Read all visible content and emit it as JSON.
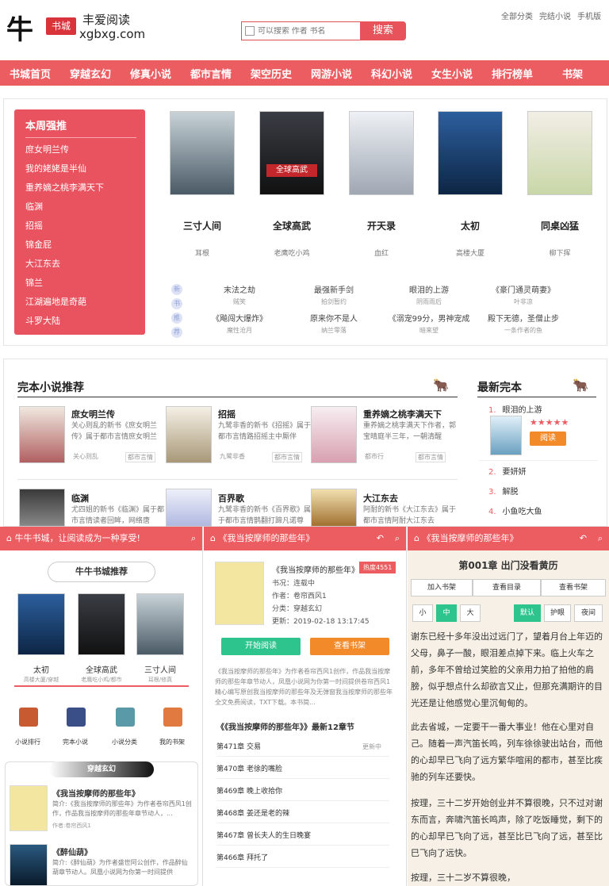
{
  "header": {
    "logo_char": "牛",
    "logo_badge": "书城",
    "logo_text1": "丰爱阅读",
    "logo_text2": "xgbxg.com",
    "search_placeholder": "可以搜索 作者 书名",
    "search_button": "搜索",
    "top_links": [
      "全部分类",
      "完结小说",
      "手机版"
    ]
  },
  "nav": [
    "书城首页",
    "穿越玄幻",
    "修真小说",
    "都市言情",
    "架空历史",
    "网游小说",
    "科幻小说",
    "女生小说",
    "排行榜单",
    "书架"
  ],
  "weekly": {
    "title": "本周强推",
    "items": [
      "庶女明兰传",
      "我的姥姥是半仙",
      "重养嫡之桃李满天下",
      "临渊",
      "招摇",
      "锦金屁",
      "大江东去",
      "锦兰",
      "江湖遍地是奇葩",
      "斗罗大陆"
    ],
    "books": [
      {
        "name": "三寸人间",
        "author": "耳根"
      },
      {
        "name": "全球高武",
        "author": "老鹰吃小鸡"
      },
      {
        "name": "开天录",
        "author": "血红"
      },
      {
        "name": "太初",
        "author": "高楼大厦"
      },
      {
        "name": "同桌凶猛",
        "author": "柳下挥"
      }
    ],
    "tags": [
      "新",
      "书",
      "推",
      "荐"
    ],
    "sub": [
      {
        "name": "末法之劫",
        "author": "贼笑"
      },
      {
        "name": "最强新手剑",
        "author": "拍剑暂约"
      },
      {
        "name": "眼泪的上游",
        "author": "阴雨雨后"
      },
      {
        "name": "《豪门通灵萌妻》",
        "author": "叶非凉"
      },
      {
        "name": "《飚闯大爆炸》",
        "author": "魔性沧月"
      },
      {
        "name": "原来你不是人",
        "author": "纳兰零落"
      },
      {
        "name": "《溺宠99分，男神宠成",
        "author": "暗来望"
      },
      {
        "name": "殿下无德，圣僧止步",
        "author": "一条作者的鱼"
      }
    ]
  },
  "complete": {
    "title": "完本小说推荐",
    "recs": [
      {
        "name": "庶女明兰传",
        "desc": "关心则乱的新书《庶女明兰传》属于都市言情庶女明兰",
        "author": "关心则乱",
        "tag": "都市言情"
      },
      {
        "name": "招摇",
        "desc": "九鹭非香的新书《招摇》属于都市言情路招摇主中厮伴",
        "author": "九鹭非香",
        "tag": "都市言情"
      },
      {
        "name": "重养嫡之桃李满天下",
        "desc": "重养嫡之桃李满天下作者，郭宝晴庭半三年，一朝清醒",
        "author": "都市行",
        "tag": "都市言情"
      },
      {
        "name": "临渊",
        "desc": "尤四姐的新书《临渊》属于都市言情读者回眸，网络唐",
        "author": "",
        "tag": ""
      },
      {
        "name": "百界歌",
        "desc": "九鹭非香的新书《百界歌》属于都市言情鹊翻打蹄凡诺尊",
        "author": "",
        "tag": ""
      },
      {
        "name": "大江东去",
        "desc": "阿耐的新书《大江东去》属于都市言情阿耐大江东去",
        "author": "",
        "tag": ""
      }
    ],
    "latest_title": "最新完本",
    "latest": [
      {
        "num": "1.",
        "name": "眼泪的上游"
      },
      {
        "num": "2.",
        "name": "要妍妍"
      },
      {
        "num": "3.",
        "name": "解脱"
      },
      {
        "num": "4.",
        "name": "小鱼吃大鱼"
      }
    ],
    "stars": "★★★★★",
    "read_btn": "阅读"
  },
  "m1": {
    "bar": "牛牛书城，让阅读成为一种享受!",
    "rec_title": "牛牛书城推荐",
    "books": [
      {
        "name": "太初",
        "meta": "高楼大厦/穿越"
      },
      {
        "name": "全球高武",
        "meta": "老鹰吃小鸡/都市"
      },
      {
        "name": "三寸人间",
        "meta": "耳根/修真"
      }
    ],
    "icons": [
      "小说排行",
      "完本小说",
      "小说分类",
      "我的书架"
    ],
    "tab": "穿越玄幻",
    "list": [
      {
        "name": "《我当按摩师的那些年》",
        "desc": "简介:《我当按摩师的那些年》为作者卷帘西风1创作，作品我当按摩师的那些年章节动人，..."
      },
      {
        "name": "《醉仙葫》",
        "desc": "简介:《醉仙葫》为作者盛世阿公创作，作品醉仙葫章节动人。凤凰小说网为你第一时间提供"
      }
    ],
    "author_label": "作者:卷帘西风1"
  },
  "m2": {
    "bar": "《我当按摩师的那些年》",
    "title": "《我当按摩师的那些年》",
    "hot": "热度4551",
    "info": [
      "书况：连载中",
      "作者：卷帘西风1",
      "分类：穿越玄幻",
      "更新：2019-02-18 13:17:45"
    ],
    "start_btn": "开始阅读",
    "shelf_btn": "查看书架",
    "desc": "《我当按摩师的那些年》为作者卷帘西风1创作，作品我当按摩师的那些年章节动人，凤凰小说网为你第一时间提供卷帘西风1精心编写原创我当按摩师的那些年及无弹窗我当按摩师的那些年全文免费阅读，TXT下载。本书简...",
    "latest_title": "《《我当按摩师的那些年》》最新12章节",
    "chapters": [
      "第471章 交易",
      "第470章 老徐的嘴脸",
      "第469章 晚上收拾你",
      "第468章 姜还是老的辣",
      "第467章 曾长夫人的生日晚宴",
      "第466章 拜托了"
    ],
    "updating": "更新中"
  },
  "m3": {
    "bar": "《我当按摩师的那些年》",
    "chapter_title": "第001章 出门没看黄历",
    "opts": [
      "加入书架",
      "查看目录",
      "查看书架"
    ],
    "sizes": [
      "小",
      "中",
      "大"
    ],
    "modes": [
      "默认",
      "护眼",
      "夜间"
    ],
    "paras": [
      "谢东已经十多年没出过远门了，望着月台上年迈的父母，鼻子一酸，眼泪差点掉下来。临上火车之前，多年不曾给过笑脸的父亲用力拍了拍他的肩膀，似乎想点什么却欲言又止，但那充满期许的目光还是让他感觉心里沉甸甸的。",
      "此去省城，一定要干一番大事业！他在心里对自己。随着一声汽笛长鸣，列车徐徐驶出站台，而他的心却早已飞向了远方繁华喧闹的都市，甚至比疾驰的列车还要快。",
      "按理，三十二岁开始创业并不算很晚，只不过对谢东而言，奔啸汽笛长鸣声，除了吃饭睡觉，剩下的的心却早已飞向了远，甚至比已飞向了远，甚至比巳飞向了远快。",
      "按理，三十二岁不算很晚，"
    ]
  }
}
